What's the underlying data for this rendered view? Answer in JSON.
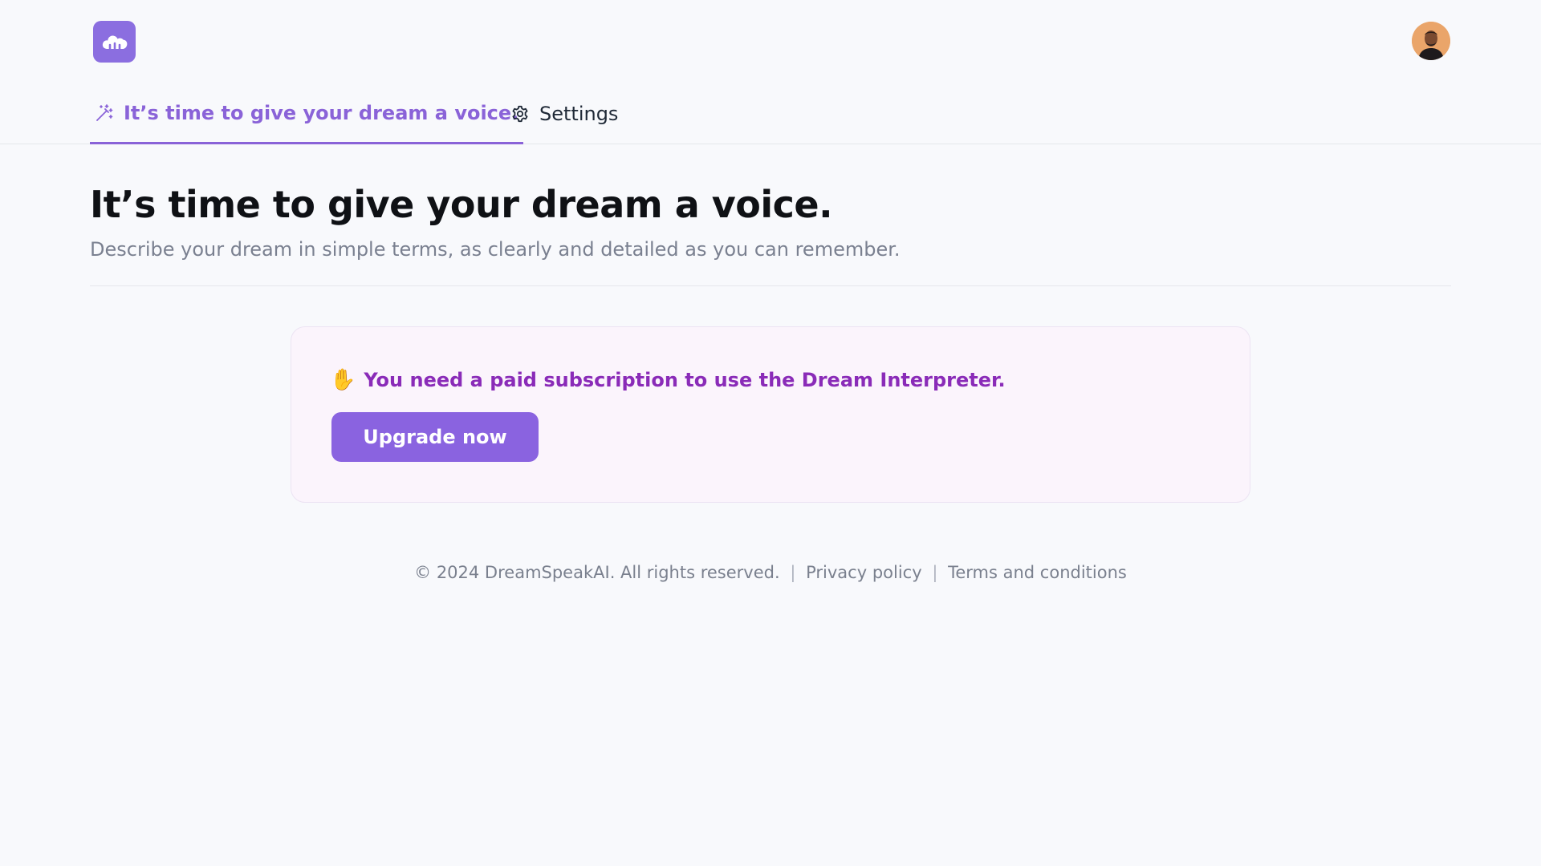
{
  "header": {
    "logo_icon": "cloud-icon",
    "avatar_icon": "user-avatar"
  },
  "tabs": [
    {
      "label": "It’s time to give your dream a voice.",
      "icon": "magic-wand-icon",
      "active": true
    },
    {
      "label": "Settings",
      "icon": "gear-icon",
      "active": false
    }
  ],
  "main": {
    "title": "It’s time to give your dream a voice.",
    "subtitle": "Describe your dream in simple terms, as clearly and detailed as you can remember."
  },
  "card": {
    "emoji": "✋",
    "message": "You need a paid subscription to use the Dream Interpreter.",
    "button_label": "Upgrade now"
  },
  "footer": {
    "copyright": "© 2024 DreamSpeakAI. All rights reserved.",
    "separator": "|",
    "privacy": "Privacy policy",
    "terms": "Terms and conditions"
  },
  "colors": {
    "accent": "#8a63d8",
    "button": "#8a63e0",
    "message": "#8a2bb8",
    "background": "#f8f9fc"
  }
}
